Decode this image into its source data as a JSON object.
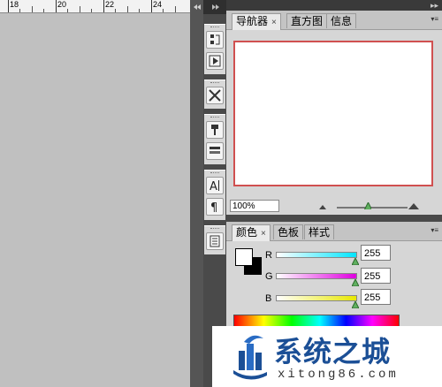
{
  "ruler": {
    "labels": [
      "18",
      "20",
      "22",
      "24"
    ]
  },
  "navigator": {
    "tabs": [
      "导航器",
      "直方图",
      "信息"
    ],
    "close_glyph": "×",
    "zoom_value": "100%"
  },
  "color": {
    "tabs": [
      "颜色",
      "色板",
      "样式"
    ],
    "close_glyph": "×",
    "channels": [
      {
        "label": "R",
        "value": "255",
        "gradient_color": "#00e5ff"
      },
      {
        "label": "G",
        "value": "255",
        "gradient_color": "#e000e0"
      },
      {
        "label": "B",
        "value": "255",
        "gradient_color": "#e8e800"
      }
    ],
    "foreground": "#ffffff",
    "background": "#000000"
  },
  "tools": [
    "history-icon",
    "actions-icon",
    "tool-presets-icon",
    "clone-source-icon",
    "layer-comps-icon",
    "character-icon",
    "paragraph-icon",
    "notes-icon"
  ],
  "watermark": {
    "title": "系统之城",
    "url": "xitong86.com",
    "brand_color": "#1b4f96"
  },
  "colors": {
    "canvas": "#c0c0c0",
    "panel_bg": "#d6d6d6",
    "preview_border": "#d05050",
    "slider_thumb": "#60b060"
  }
}
